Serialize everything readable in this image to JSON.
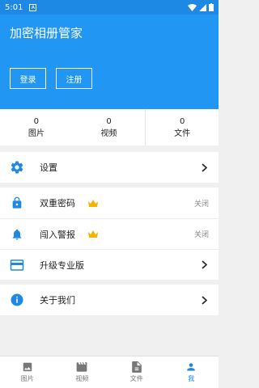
{
  "status": {
    "time": "5:01"
  },
  "header": {
    "title": "加密相册管家",
    "login": "登录",
    "register": "注册",
    "color": "#2196f3"
  },
  "stats": [
    {
      "value": "0",
      "label": "图片"
    },
    {
      "value": "0",
      "label": "视频"
    },
    {
      "value": "0",
      "label": "文件"
    }
  ],
  "menu": {
    "settings": "设置",
    "double_password": "双重密码",
    "double_password_value": "关闭",
    "intruder_alert": "闯入警报",
    "intruder_alert_value": "关闭",
    "upgrade": "升级专业版",
    "about": "关于我们"
  },
  "nav": [
    {
      "label": "图片",
      "icon": "image-icon"
    },
    {
      "label": "视频",
      "icon": "video-icon"
    },
    {
      "label": "文件",
      "icon": "file-icon"
    },
    {
      "label": "我",
      "icon": "person-icon",
      "active": true
    }
  ]
}
